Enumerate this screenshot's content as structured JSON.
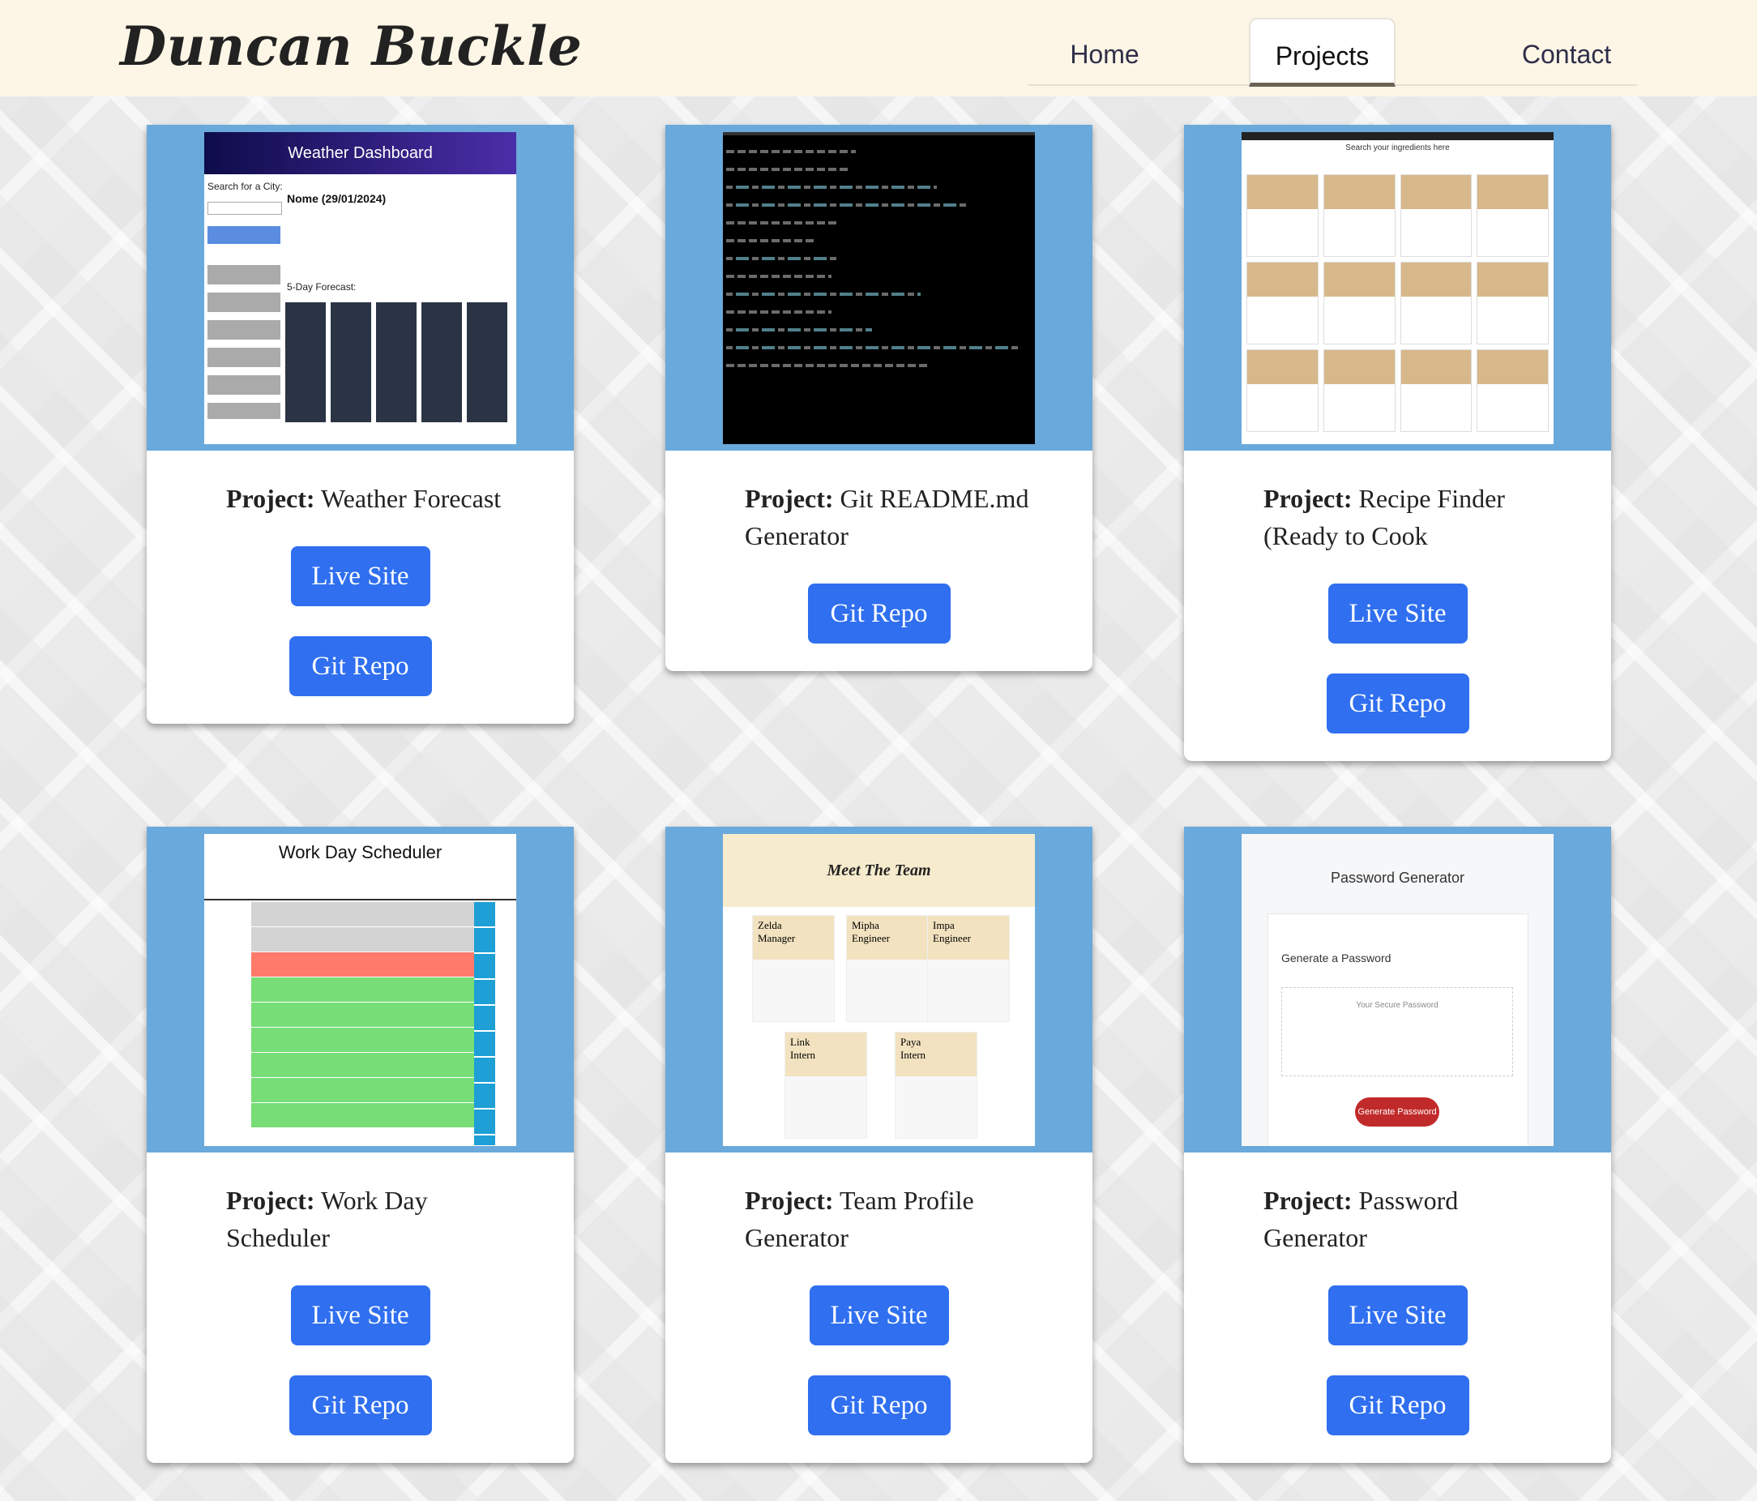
{
  "brand": "Duncan Buckle",
  "nav": {
    "home": "Home",
    "projects": "Projects",
    "contact": "Contact"
  },
  "project_prefix": "Project:",
  "projects": [
    {
      "name": "Weather Forecast",
      "live_label": "Live Site",
      "repo_label": "Git Repo",
      "thumb_title": "Weather Dashboard"
    },
    {
      "name": "Git README.md Generator",
      "repo_label": "Git Repo"
    },
    {
      "name": "Recipe Finder (Ready to Cook",
      "live_label": "Live Site",
      "repo_label": "Git Repo",
      "thumb_title": "Search your ingredients here"
    },
    {
      "name": "Work Day Scheduler",
      "live_label": "Live Site",
      "repo_label": "Git Repo",
      "thumb_title": "Work Day Scheduler"
    },
    {
      "name": "Team Profile Generator",
      "live_label": "Live Site",
      "repo_label": "Git Repo",
      "thumb_title": "Meet The Team"
    },
    {
      "name": "Password Generator",
      "live_label": "Live Site",
      "repo_label": "Git Repo",
      "thumb_title": "Password Generator",
      "thumb_subtitle": "Generate a Password",
      "thumb_placeholder": "Your Secure Password",
      "thumb_button": "Generate Password"
    }
  ],
  "weather_thumb": {
    "city_label": "Search for a City:",
    "current": "Nome (29/01/2024)",
    "forecast": "5-Day Forecast:"
  },
  "team_thumb": {
    "members": [
      "Zelda",
      "Mipha",
      "Impa",
      "Link",
      "Paya"
    ],
    "roles": [
      "Manager",
      "Engineer",
      "Engineer",
      "Intern",
      "Intern"
    ]
  },
  "colors": {
    "header_bg": "#fdf6e6",
    "card_top": "#6aa9db",
    "button": "#2f6ff0"
  }
}
